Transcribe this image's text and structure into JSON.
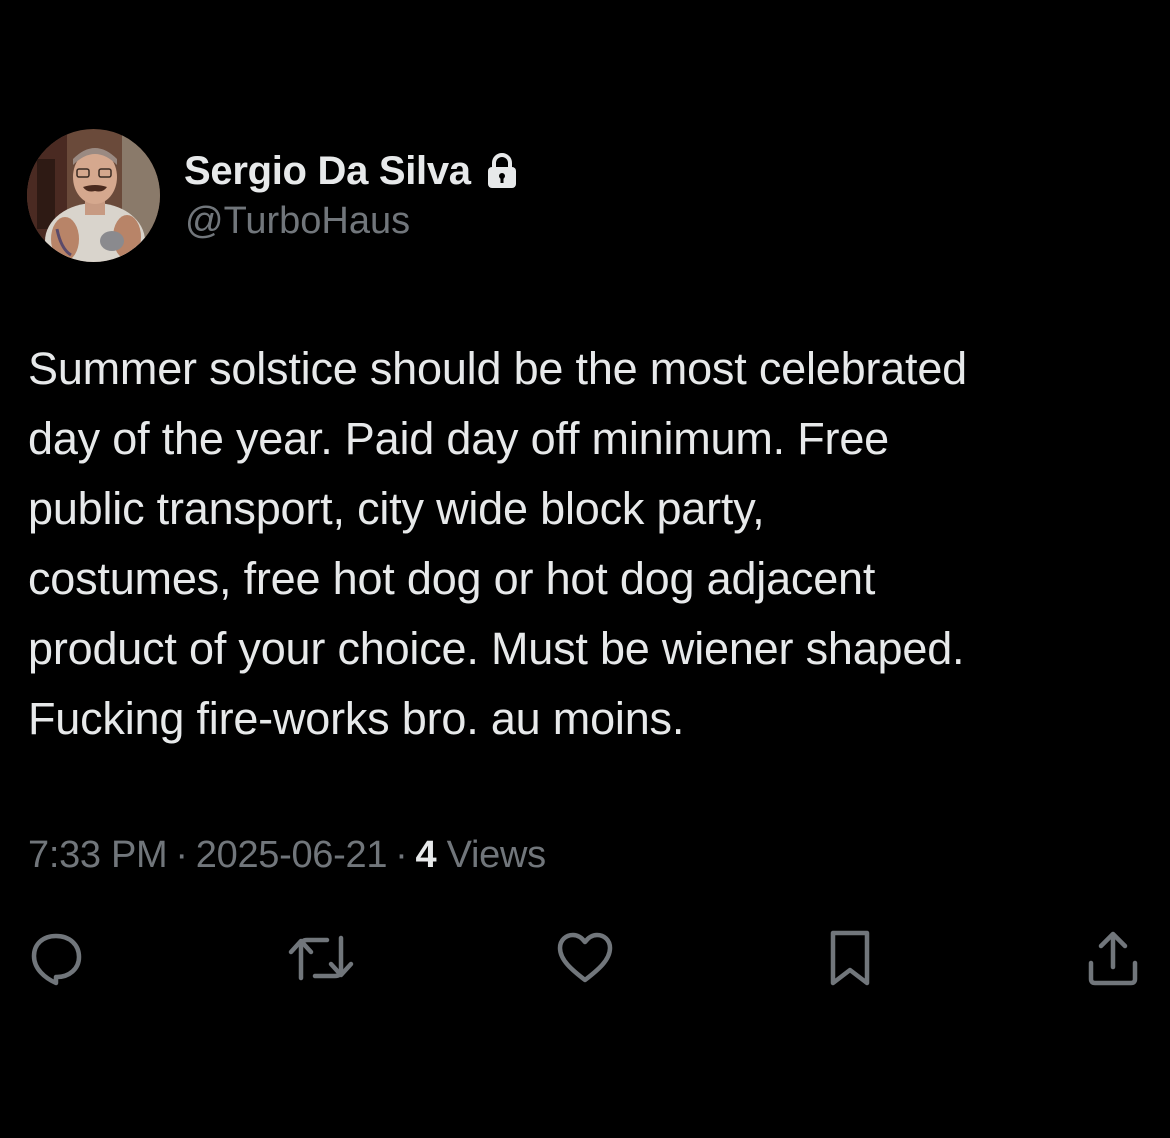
{
  "tweet": {
    "author": {
      "display_name": "Sergio Da Silva",
      "handle": "@TurboHaus",
      "protected_icon": "lock-icon",
      "avatar_icon": "avatar"
    },
    "text_lines": [
      "Summer solstice should be the most celebrated",
      "day of the year. Paid day off minimum. Free",
      "public transport, city wide block party,",
      "costumes, free hot dog or hot dog adjacent",
      "product of your choice. Must be wiener shaped.",
      "Fucking fire-works bro. au moins."
    ],
    "meta": {
      "time": "7:33 PM",
      "date": "2025-06-21",
      "views_count": "4",
      "views_label": "Views",
      "separator": "·"
    },
    "actions": [
      {
        "name": "reply",
        "icon": "reply-icon"
      },
      {
        "name": "retweet",
        "icon": "retweet-icon"
      },
      {
        "name": "like",
        "icon": "heart-icon"
      },
      {
        "name": "bookmark",
        "icon": "bookmark-icon"
      },
      {
        "name": "share",
        "icon": "share-icon"
      }
    ]
  },
  "colors": {
    "background": "#000000",
    "text_primary": "#e7e9ea",
    "text_secondary": "#71767b"
  }
}
